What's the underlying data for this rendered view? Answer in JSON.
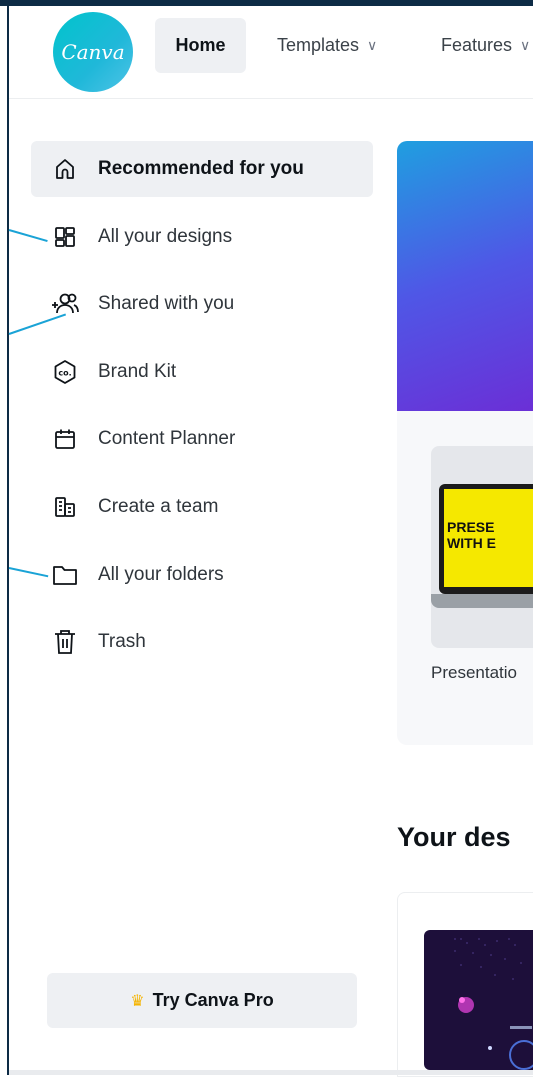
{
  "header": {
    "logo_text": "Canva",
    "nav": [
      {
        "label": "Home",
        "active": true
      },
      {
        "label": "Templates",
        "has_dropdown": true
      },
      {
        "label": "Features",
        "has_dropdown": true
      }
    ]
  },
  "sidebar": {
    "items": [
      {
        "label": "Recommended for you",
        "icon": "home-icon",
        "active": true
      },
      {
        "label": "All your designs",
        "icon": "grid-icon"
      },
      {
        "label": "Shared with you",
        "icon": "shared-users-icon"
      },
      {
        "label": "Brand Kit",
        "icon": "brand-kit-icon"
      },
      {
        "label": "Content Planner",
        "icon": "calendar-icon"
      },
      {
        "label": "Create a team",
        "icon": "team-icon"
      },
      {
        "label": "All your folders",
        "icon": "folder-icon"
      },
      {
        "label": "Trash",
        "icon": "trash-icon"
      }
    ],
    "pro_button": {
      "label": "Try Canva Pro",
      "icon": "crown-icon"
    }
  },
  "main": {
    "card": {
      "label": "Presentatio",
      "thumb_text_line1": "PRESE",
      "thumb_text_line2": "WITH E"
    },
    "section_title": "Your des"
  },
  "colors": {
    "brand": "#00c4cc",
    "frame": "#0d2b45",
    "annotation": "#1aa3d6",
    "crown": "#f5b400"
  }
}
